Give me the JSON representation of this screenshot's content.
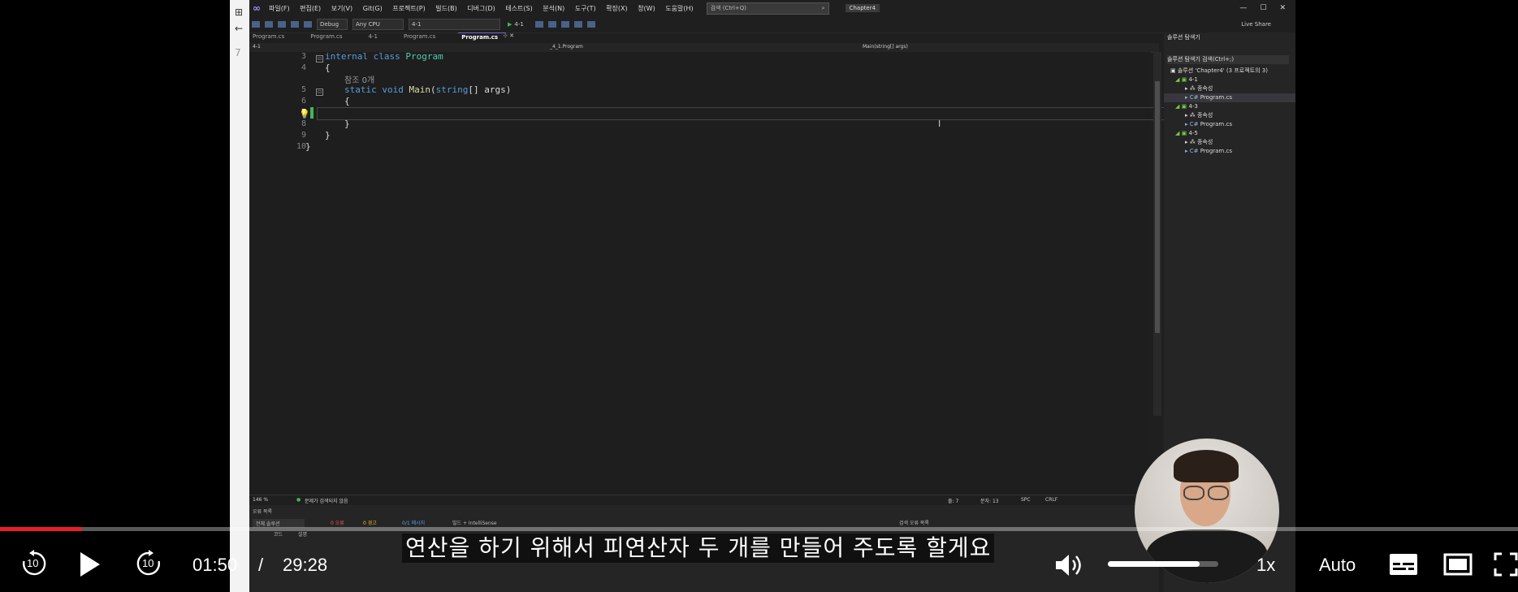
{
  "ide": {
    "left_strip_items": [
      "⊞",
      "←",
      "7"
    ],
    "menu": [
      "파일(F)",
      "편집(E)",
      "보기(V)",
      "Git(G)",
      "프로젝트(P)",
      "빌드(B)",
      "디버그(D)",
      "테스트(S)",
      "분석(N)",
      "도구(T)",
      "확장(X)",
      "창(W)",
      "도움말(H)"
    ],
    "search_placeholder": "검색 (Ctrl+Q)",
    "solution_name": "Chapter4",
    "window_buttons": [
      "—",
      "☐",
      "✕"
    ],
    "toolbar": {
      "config": "Debug",
      "platform": "Any CPU",
      "project": "4-1",
      "run_target": "4-1",
      "live_share": "Live Share"
    },
    "tabs": [
      "Program.cs",
      "Program.cs",
      "4-1",
      "Program.cs",
      "Program.cs"
    ],
    "active_tab_index": 4,
    "nav": {
      "project": "4-1",
      "class": "_4_1.Program",
      "member": "Main(string[] args)"
    },
    "code_lines": [
      {
        "num": "3",
        "tokens": [
          {
            "t": "internal ",
            "c": "kw"
          },
          {
            "t": "class ",
            "c": "kw"
          },
          {
            "t": "Program",
            "c": "typ"
          }
        ]
      },
      {
        "num": "4",
        "tokens": [
          {
            "t": "{",
            "c": "pl"
          }
        ]
      },
      {
        "num": "",
        "tokens": [
          {
            "t": "참조 0개",
            "c": "ref"
          }
        ]
      },
      {
        "num": "5",
        "tokens": [
          {
            "t": "static ",
            "c": "kw"
          },
          {
            "t": "void ",
            "c": "kw"
          },
          {
            "t": "Main",
            "c": "fn"
          },
          {
            "t": "(",
            "c": "pl"
          },
          {
            "t": "string",
            "c": "kw"
          },
          {
            "t": "[] args)",
            "c": "pl"
          }
        ]
      },
      {
        "num": "6",
        "tokens": [
          {
            "t": "{",
            "c": "pl"
          }
        ]
      },
      {
        "num": "7",
        "tokens": [
          {
            "t": "",
            "c": "pl"
          }
        ]
      },
      {
        "num": "8",
        "tokens": [
          {
            "t": "}",
            "c": "pl"
          }
        ]
      },
      {
        "num": "9",
        "tokens": [
          {
            "t": "}",
            "c": "pl"
          }
        ]
      },
      {
        "num": "10",
        "tokens": [
          {
            "t": "}",
            "c": "pl"
          }
        ]
      }
    ],
    "status": {
      "zoom": "146 %",
      "issues": "문제가 검색되지 않음",
      "line": "줄: 7",
      "col": "문자: 13",
      "spc": "SPC",
      "crlf": "CRLF"
    },
    "error_panel": {
      "title": "오류 목록",
      "scope": "전체 솔루션",
      "errors": "0 오류",
      "warnings": "0 경고",
      "messages": "0/1 메시지",
      "build": "빌드 + IntelliSense",
      "search": "검색 오류 목록",
      "col1": "코드",
      "col2": "설명"
    },
    "solution_explorer": {
      "title": "솔루션 탐색기",
      "search": "솔루션 탐색기 검색(Ctrl+;)",
      "solution": "솔루션 'Chapter4' (3 프로젝트의 3)",
      "items": [
        {
          "label": "4-1",
          "kind": "proj"
        },
        {
          "label": "종속성",
          "kind": "dep"
        },
        {
          "label": "Program.cs",
          "kind": "file",
          "selected": true
        },
        {
          "label": "4-3",
          "kind": "proj"
        },
        {
          "label": "종속성",
          "kind": "dep"
        },
        {
          "label": "Program.cs",
          "kind": "file"
        },
        {
          "label": "4-5",
          "kind": "proj"
        },
        {
          "label": "종속성",
          "kind": "dep"
        },
        {
          "label": "Program.cs",
          "kind": "file"
        }
      ]
    }
  },
  "player": {
    "subtitle": "연산을 하기 위해서 피연산자 두 개를 만들어 주도록 할게요",
    "current_time": "01:50",
    "separator": "/",
    "duration": "29:28",
    "progress_fraction": 0.054,
    "volume_fraction": 0.83,
    "rewind_seconds": "10",
    "forward_seconds": "10",
    "speed": "1x",
    "quality": "Auto",
    "accent_color": "#e81e2b"
  }
}
